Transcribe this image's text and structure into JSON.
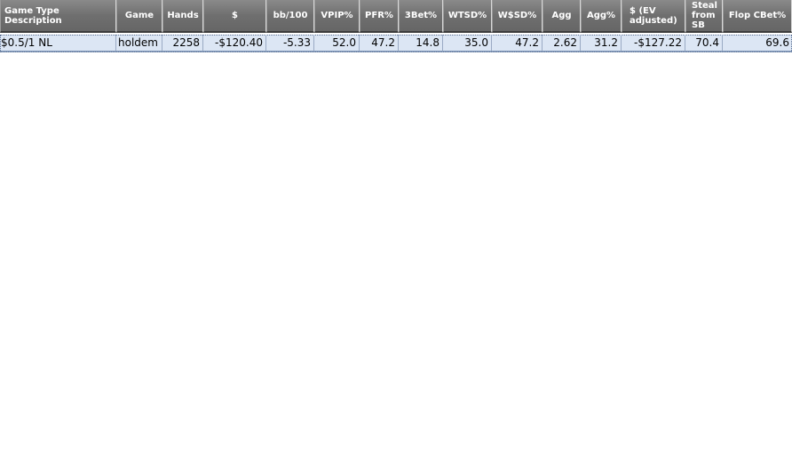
{
  "columns": [
    {
      "key": "game_type_description",
      "label": "Game Type Description"
    },
    {
      "key": "game",
      "label": "Game"
    },
    {
      "key": "hands",
      "label": "Hands"
    },
    {
      "key": "dollars",
      "label": "$"
    },
    {
      "key": "bb100",
      "label": "bb/100"
    },
    {
      "key": "vpip",
      "label": "VPIP%"
    },
    {
      "key": "pfr",
      "label": "PFR%"
    },
    {
      "key": "threebet",
      "label": "3Bet%"
    },
    {
      "key": "wtsd",
      "label": "WTSD%"
    },
    {
      "key": "wsd",
      "label": "W$SD%"
    },
    {
      "key": "agg",
      "label": "Agg"
    },
    {
      "key": "agg_pct",
      "label": "Agg%"
    },
    {
      "key": "ev_adjusted",
      "label": "$ (EV adjusted)"
    },
    {
      "key": "steal_from_sb",
      "label": "Steal from SB"
    },
    {
      "key": "flop_cbet",
      "label": "Flop CBet%"
    }
  ],
  "rows": [
    {
      "game_type_description": "$0.5/1 NL",
      "game": "holdem",
      "hands": "2258",
      "dollars": "-$120.40",
      "bb100": "-5.33",
      "vpip": "52.0",
      "pfr": "47.2",
      "threebet": "14.8",
      "wtsd": "35.0",
      "wsd": "47.2",
      "agg": "2.62",
      "agg_pct": "31.2",
      "ev_adjusted": "-$127.22",
      "steal_from_sb": "70.4",
      "flop_cbet": "69.6"
    }
  ]
}
